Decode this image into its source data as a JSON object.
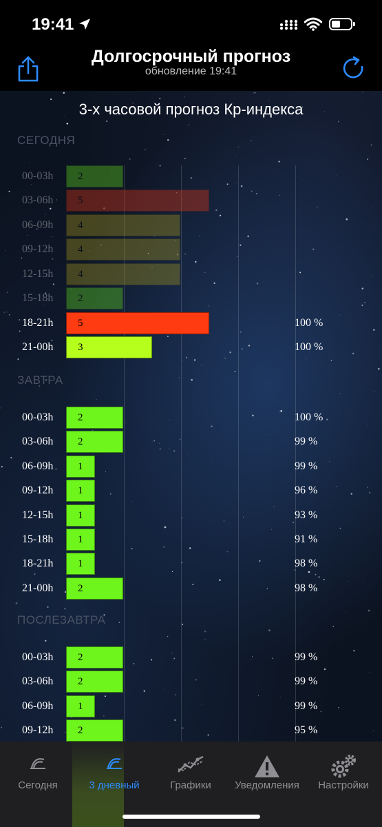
{
  "status_bar": {
    "time": "19:41"
  },
  "header": {
    "title": "Долгосрочный прогноз",
    "subtitle": "обновление 19:41"
  },
  "chart_title": "3-х часовой прогноз Кр-индекса",
  "sections": {
    "today": "СЕГОДНЯ",
    "tomorrow": "ЗАВТРА",
    "after_tomorrow": "ПОСЛЕЗАВТРА"
  },
  "colors": {
    "kp1": "#6ef51c",
    "kp2": "#6ef51c",
    "kp3": "#b6ff1c",
    "kp4": "#b9a71a",
    "kp5": "#ff3b12",
    "accent": "#2d8cff"
  },
  "rows": [
    {
      "time": "00-03h",
      "kp": 2,
      "pct": "",
      "past": true
    },
    {
      "time": "03-06h",
      "kp": 5,
      "pct": "",
      "past": true
    },
    {
      "time": "06-09h",
      "kp": 4,
      "pct": "",
      "past": true
    },
    {
      "time": "09-12h",
      "kp": 4,
      "pct": "",
      "past": true
    },
    {
      "time": "12-15h",
      "kp": 4,
      "pct": "",
      "past": true
    },
    {
      "time": "15-18h",
      "kp": 2,
      "pct": "",
      "past": true
    },
    {
      "time": "18-21h",
      "kp": 5,
      "pct": "100 %",
      "past": false
    },
    {
      "time": "21-00h",
      "kp": 3,
      "pct": "100 %",
      "past": false
    },
    {
      "time": "00-03h",
      "kp": 2,
      "pct": "100 %",
      "past": false
    },
    {
      "time": "03-06h",
      "kp": 2,
      "pct": "99 %",
      "past": false
    },
    {
      "time": "06-09h",
      "kp": 1,
      "pct": "99 %",
      "past": false
    },
    {
      "time": "09-12h",
      "kp": 1,
      "pct": "96 %",
      "past": false
    },
    {
      "time": "12-15h",
      "kp": 1,
      "pct": "93 %",
      "past": false
    },
    {
      "time": "15-18h",
      "kp": 1,
      "pct": "91 %",
      "past": false
    },
    {
      "time": "18-21h",
      "kp": 1,
      "pct": "98 %",
      "past": false
    },
    {
      "time": "21-00h",
      "kp": 2,
      "pct": "98 %",
      "past": false
    },
    {
      "time": "00-03h",
      "kp": 2,
      "pct": "99 %",
      "past": false
    },
    {
      "time": "03-06h",
      "kp": 2,
      "pct": "99 %",
      "past": false
    },
    {
      "time": "06-09h",
      "kp": 1,
      "pct": "99 %",
      "past": false
    },
    {
      "time": "09-12h",
      "kp": 2,
      "pct": "95 %",
      "past": false
    }
  ],
  "tabs": [
    {
      "label": "Сегодня",
      "icon": "aurora-icon",
      "active": false
    },
    {
      "label": "3 дневный",
      "icon": "aurora-icon",
      "active": true
    },
    {
      "label": "Графики",
      "icon": "chart-icon",
      "active": false
    },
    {
      "label": "Уведомления",
      "icon": "warning-icon",
      "active": false
    },
    {
      "label": "Настройки",
      "icon": "gears-icon",
      "active": false
    }
  ]
}
